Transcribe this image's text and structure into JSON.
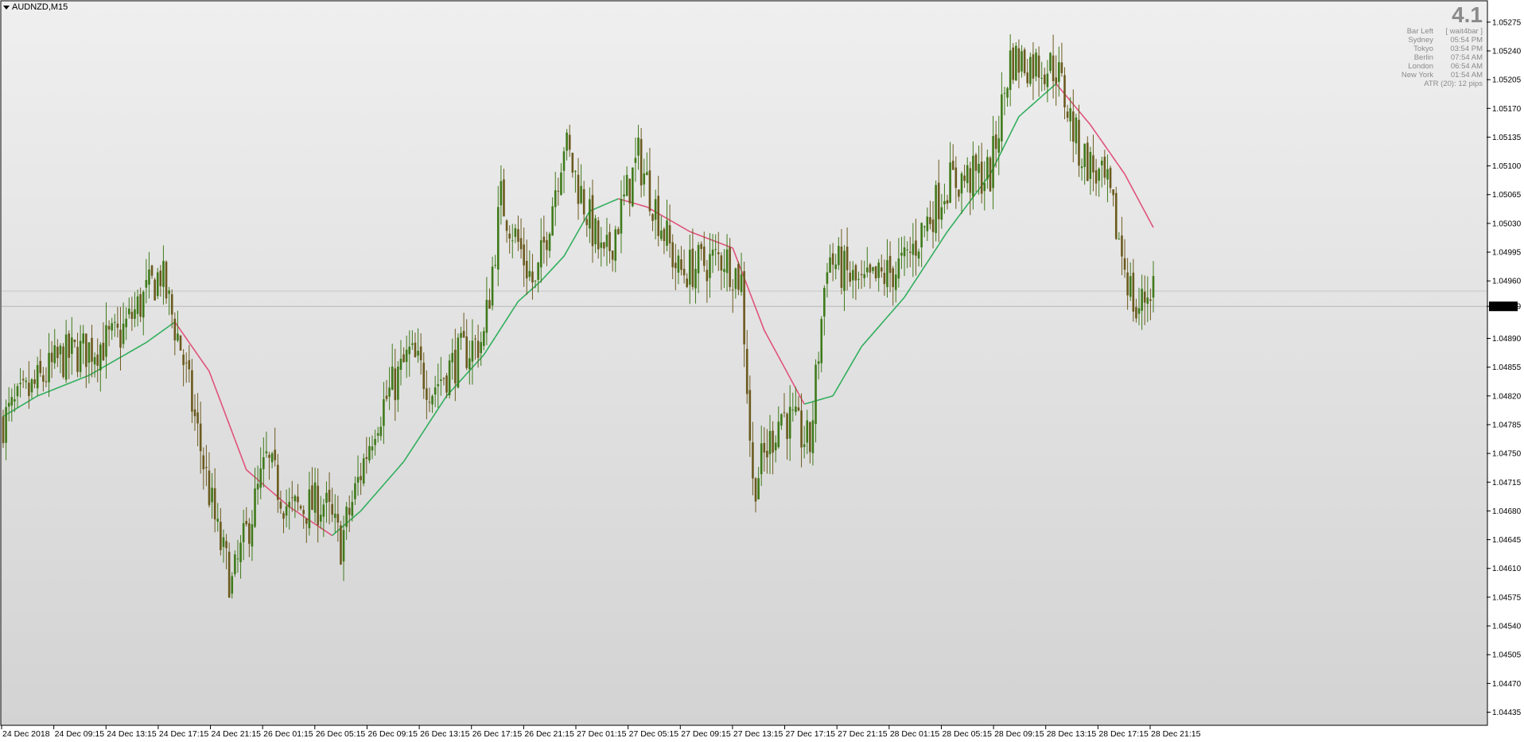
{
  "window": {
    "symbol_title": "AUDNZD,M15"
  },
  "info_panel": {
    "value": "4.1",
    "rows": [
      {
        "label": "Bar Left",
        "value": "[ wait4bar ]"
      },
      {
        "label": "Sydney",
        "value": "05:54 PM"
      },
      {
        "label": "Tokyo",
        "value": "03:54 PM"
      },
      {
        "label": "Berlin",
        "value": "07:54 AM"
      },
      {
        "label": "London",
        "value": "06:54 AM"
      },
      {
        "label": "New York",
        "value": "01:54 AM"
      }
    ],
    "atr": "ATR (20): 12 pips"
  },
  "colors": {
    "bull_candle": "#3f7a1a",
    "bear_candle": "#6b5a1e",
    "ma_up": "#2fae5b",
    "ma_down": "#e0517a",
    "bg_top": "#efefef",
    "bg_bottom": "#d4d4d4"
  },
  "chart_data": {
    "type": "candlestick",
    "symbol": "AUDNZD",
    "timeframe": "M15",
    "ylim": [
      1.0442,
      1.053
    ],
    "y_ticks": [
      "1.05275",
      "1.05240",
      "1.05205",
      "1.05170",
      "1.05135",
      "1.05100",
      "1.05065",
      "1.05030",
      "1.04995",
      "1.04960",
      "1.04929",
      "1.04890",
      "1.04855",
      "1.04820",
      "1.04785",
      "1.04750",
      "1.04715",
      "1.04680",
      "1.04645",
      "1.04610",
      "1.04575",
      "1.04540",
      "1.04505",
      "1.04470",
      "1.04435"
    ],
    "current_price": "1.04929",
    "x_labels": [
      "24 Dec 2018",
      "24 Dec 09:15",
      "24 Dec 13:15",
      "24 Dec 17:15",
      "24 Dec 21:15",
      "26 Dec 01:15",
      "26 Dec 05:15",
      "26 Dec 09:15",
      "26 Dec 13:15",
      "26 Dec 17:15",
      "26 Dec 21:15",
      "27 Dec 01:15",
      "27 Dec 05:15",
      "27 Dec 09:15",
      "27 Dec 13:15",
      "27 Dec 17:15",
      "27 Dec 21:15",
      "28 Dec 01:15",
      "28 Dec 05:15",
      "28 Dec 09:15",
      "28 Dec 13:15",
      "28 Dec 17:15",
      "28 Dec 21:15"
    ],
    "close_path": [
      {
        "bar": 0,
        "price": 1.0479
      },
      {
        "bar": 20,
        "price": 1.04865
      },
      {
        "bar": 40,
        "price": 1.0489
      },
      {
        "bar": 55,
        "price": 1.0497
      },
      {
        "bar": 62,
        "price": 1.0488
      },
      {
        "bar": 75,
        "price": 1.0465
      },
      {
        "bar": 80,
        "price": 1.0459
      },
      {
        "bar": 92,
        "price": 1.0474
      },
      {
        "bar": 100,
        "price": 1.0468
      },
      {
        "bar": 112,
        "price": 1.0469
      },
      {
        "bar": 118,
        "price": 1.0464
      },
      {
        "bar": 130,
        "price": 1.0479
      },
      {
        "bar": 142,
        "price": 1.0487
      },
      {
        "bar": 150,
        "price": 1.0483
      },
      {
        "bar": 160,
        "price": 1.0487
      },
      {
        "bar": 168,
        "price": 1.0489
      },
      {
        "bar": 174,
        "price": 1.0506
      },
      {
        "bar": 186,
        "price": 1.0495
      },
      {
        "bar": 196,
        "price": 1.0513
      },
      {
        "bar": 210,
        "price": 1.0498
      },
      {
        "bar": 222,
        "price": 1.0511
      },
      {
        "bar": 236,
        "price": 1.0497
      },
      {
        "bar": 252,
        "price": 1.0499
      },
      {
        "bar": 258,
        "price": 1.0496
      },
      {
        "bar": 262,
        "price": 1.0471
      },
      {
        "bar": 272,
        "price": 1.048
      },
      {
        "bar": 282,
        "price": 1.0476
      },
      {
        "bar": 288,
        "price": 1.0499
      },
      {
        "bar": 300,
        "price": 1.0495
      },
      {
        "bar": 315,
        "price": 1.0498
      },
      {
        "bar": 330,
        "price": 1.0508
      },
      {
        "bar": 345,
        "price": 1.0509
      },
      {
        "bar": 352,
        "price": 1.0523
      },
      {
        "bar": 368,
        "price": 1.0522
      },
      {
        "bar": 376,
        "price": 1.0512
      },
      {
        "bar": 386,
        "price": 1.0507
      },
      {
        "bar": 396,
        "price": 1.0492
      },
      {
        "bar": 402,
        "price": 1.0496
      }
    ],
    "ma_path": [
      {
        "bar": 0,
        "price": 1.04795
      },
      {
        "bar": 12,
        "price": 1.0482
      },
      {
        "bar": 30,
        "price": 1.04845
      },
      {
        "bar": 50,
        "price": 1.04885
      },
      {
        "bar": 60,
        "price": 1.0491
      },
      {
        "bar": 72,
        "price": 1.0485
      },
      {
        "bar": 85,
        "price": 1.0473
      },
      {
        "bar": 100,
        "price": 1.04685
      },
      {
        "bar": 115,
        "price": 1.0465
      },
      {
        "bar": 125,
        "price": 1.0468
      },
      {
        "bar": 140,
        "price": 1.0474
      },
      {
        "bar": 155,
        "price": 1.0482
      },
      {
        "bar": 168,
        "price": 1.0487
      },
      {
        "bar": 180,
        "price": 1.04935
      },
      {
        "bar": 188,
        "price": 1.0496
      },
      {
        "bar": 196,
        "price": 1.0499
      },
      {
        "bar": 205,
        "price": 1.05045
      },
      {
        "bar": 215,
        "price": 1.0506
      },
      {
        "bar": 225,
        "price": 1.0505
      },
      {
        "bar": 240,
        "price": 1.0502
      },
      {
        "bar": 255,
        "price": 1.05
      },
      {
        "bar": 266,
        "price": 1.049
      },
      {
        "bar": 280,
        "price": 1.0481
      },
      {
        "bar": 290,
        "price": 1.0482
      },
      {
        "bar": 300,
        "price": 1.0488
      },
      {
        "bar": 315,
        "price": 1.0494
      },
      {
        "bar": 330,
        "price": 1.0502
      },
      {
        "bar": 345,
        "price": 1.0509
      },
      {
        "bar": 355,
        "price": 1.0516
      },
      {
        "bar": 368,
        "price": 1.052
      },
      {
        "bar": 380,
        "price": 1.0515
      },
      {
        "bar": 392,
        "price": 1.0509
      },
      {
        "bar": 402,
        "price": 1.05025
      }
    ],
    "total_bars": 403,
    "grid": false
  }
}
